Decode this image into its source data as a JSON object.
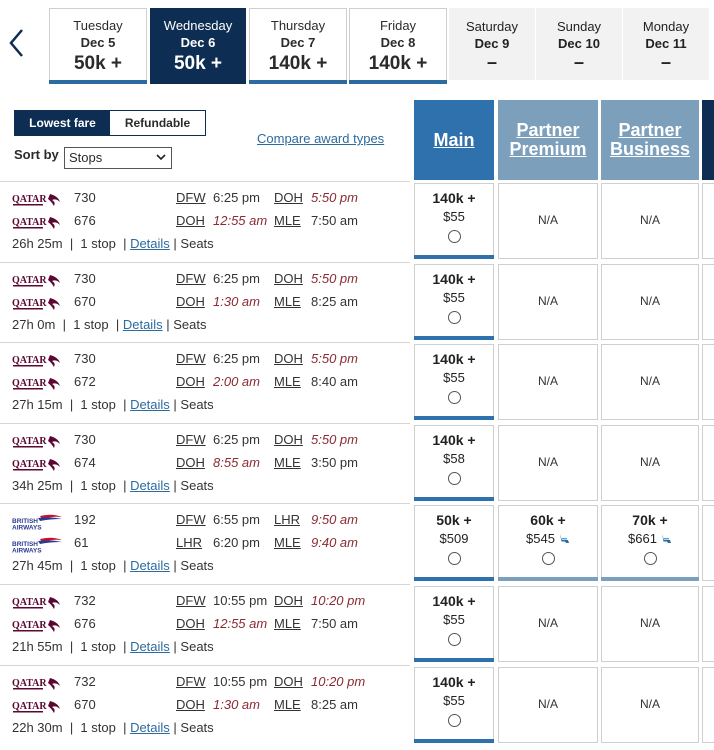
{
  "dates": [
    {
      "dow": "Tuesday",
      "date": "Dec 5",
      "price": "50k +",
      "state": "bordered"
    },
    {
      "dow": "Wednesday",
      "date": "Dec 6",
      "price": "50k +",
      "state": "selected"
    },
    {
      "dow": "Thursday",
      "date": "Dec 7",
      "price": "140k +",
      "state": "bordered"
    },
    {
      "dow": "Friday",
      "date": "Dec 8",
      "price": "140k +",
      "state": "bordered"
    },
    {
      "dow": "Saturday",
      "date": "Dec 9",
      "price": "–",
      "state": "disabled"
    },
    {
      "dow": "Sunday",
      "date": "Dec 10",
      "price": "–",
      "state": "disabled"
    },
    {
      "dow": "Monday",
      "date": "Dec 11",
      "price": "–",
      "state": "disabled"
    }
  ],
  "filters": {
    "lowest_fare": "Lowest fare",
    "refundable": "Refundable",
    "sort_label": "Sort by",
    "sort_value": "Stops",
    "compare_link": "Compare award types"
  },
  "columns": {
    "main": "Main",
    "pp_1": "Partner",
    "pp_2": "Premium",
    "pb_1": "Partner",
    "pb_2": "Business"
  },
  "colors": {
    "navy": "#0d2e52",
    "main_blue": "#2f71ad",
    "partner_blue": "#7c9fbc",
    "link": "#2c6b9f",
    "arrival_red": "#8b2a33"
  },
  "flights": [
    {
      "airline": "QATAR",
      "segments": [
        {
          "num": "730",
          "from": "DFW",
          "dep": "6:25 pm",
          "dep_red": false,
          "to": "DOH",
          "arr": "5:50 pm",
          "arr_red": true
        },
        {
          "num": "676",
          "from": "DOH",
          "dep": "12:55 am",
          "dep_red": true,
          "to": "MLE",
          "arr": "7:50 am",
          "arr_red": false
        }
      ],
      "duration": "26h 25m",
      "stops": "1 stop",
      "details": "Details",
      "seats": "Seats",
      "main": {
        "miles": "140k +",
        "tax": "$55"
      },
      "pp": {
        "na": "N/A"
      },
      "pb": {
        "na": "N/A"
      }
    },
    {
      "airline": "QATAR",
      "segments": [
        {
          "num": "730",
          "from": "DFW",
          "dep": "6:25 pm",
          "dep_red": false,
          "to": "DOH",
          "arr": "5:50 pm",
          "arr_red": true
        },
        {
          "num": "670",
          "from": "DOH",
          "dep": "1:30 am",
          "dep_red": true,
          "to": "MLE",
          "arr": "8:25 am",
          "arr_red": false
        }
      ],
      "duration": "27h 0m",
      "stops": "1 stop",
      "details": "Details",
      "seats": "Seats",
      "main": {
        "miles": "140k +",
        "tax": "$55"
      },
      "pp": {
        "na": "N/A"
      },
      "pb": {
        "na": "N/A"
      }
    },
    {
      "airline": "QATAR",
      "segments": [
        {
          "num": "730",
          "from": "DFW",
          "dep": "6:25 pm",
          "dep_red": false,
          "to": "DOH",
          "arr": "5:50 pm",
          "arr_red": true
        },
        {
          "num": "672",
          "from": "DOH",
          "dep": "2:00 am",
          "dep_red": true,
          "to": "MLE",
          "arr": "8:40 am",
          "arr_red": false
        }
      ],
      "duration": "27h 15m",
      "stops": "1 stop",
      "details": "Details",
      "seats": "Seats",
      "main": {
        "miles": "140k +",
        "tax": "$55"
      },
      "pp": {
        "na": "N/A"
      },
      "pb": {
        "na": "N/A"
      }
    },
    {
      "airline": "QATAR",
      "segments": [
        {
          "num": "730",
          "from": "DFW",
          "dep": "6:25 pm",
          "dep_red": false,
          "to": "DOH",
          "arr": "5:50 pm",
          "arr_red": true
        },
        {
          "num": "674",
          "from": "DOH",
          "dep": "8:55 am",
          "dep_red": true,
          "to": "MLE",
          "arr": "3:50 pm",
          "arr_red": false
        }
      ],
      "duration": "34h 25m",
      "stops": "1 stop",
      "details": "Details",
      "seats": "Seats",
      "main": {
        "miles": "140k +",
        "tax": "$58"
      },
      "pp": {
        "na": "N/A"
      },
      "pb": {
        "na": "N/A"
      }
    },
    {
      "airline": "BRITISH AIRWAYS",
      "segments": [
        {
          "num": "192",
          "from": "DFW",
          "dep": "6:55 pm",
          "dep_red": false,
          "to": "LHR",
          "arr": "9:50 am",
          "arr_red": true
        },
        {
          "num": "61",
          "from": "LHR",
          "dep": "6:20 pm",
          "dep_red": false,
          "to": "MLE",
          "arr": "9:40 am",
          "arr_red": true
        }
      ],
      "duration": "27h 45m",
      "stops": "1 stop",
      "details": "Details",
      "seats": "Seats",
      "main": {
        "miles": "50k +",
        "tax": "$509"
      },
      "pp": {
        "miles": "60k +",
        "tax": "$545"
      },
      "pb": {
        "miles": "70k +",
        "tax": "$661"
      }
    },
    {
      "airline": "QATAR",
      "segments": [
        {
          "num": "732",
          "from": "DFW",
          "dep": "10:55 pm",
          "dep_red": false,
          "to": "DOH",
          "arr": "10:20 pm",
          "arr_red": true
        },
        {
          "num": "676",
          "from": "DOH",
          "dep": "12:55 am",
          "dep_red": true,
          "to": "MLE",
          "arr": "7:50 am",
          "arr_red": false
        }
      ],
      "duration": "21h 55m",
      "stops": "1 stop",
      "details": "Details",
      "seats": "Seats",
      "main": {
        "miles": "140k +",
        "tax": "$55"
      },
      "pp": {
        "na": "N/A"
      },
      "pb": {
        "na": "N/A"
      }
    },
    {
      "airline": "QATAR",
      "segments": [
        {
          "num": "732",
          "from": "DFW",
          "dep": "10:55 pm",
          "dep_red": false,
          "to": "DOH",
          "arr": "10:20 pm",
          "arr_red": true
        },
        {
          "num": "670",
          "from": "DOH",
          "dep": "1:30 am",
          "dep_red": true,
          "to": "MLE",
          "arr": "8:25 am",
          "arr_red": false
        }
      ],
      "duration": "22h 30m",
      "stops": "1 stop",
      "details": "Details",
      "seats": "Seats",
      "main": {
        "miles": "140k +",
        "tax": "$55"
      },
      "pp": {
        "na": "N/A"
      },
      "pb": {
        "na": "N/A"
      }
    }
  ]
}
